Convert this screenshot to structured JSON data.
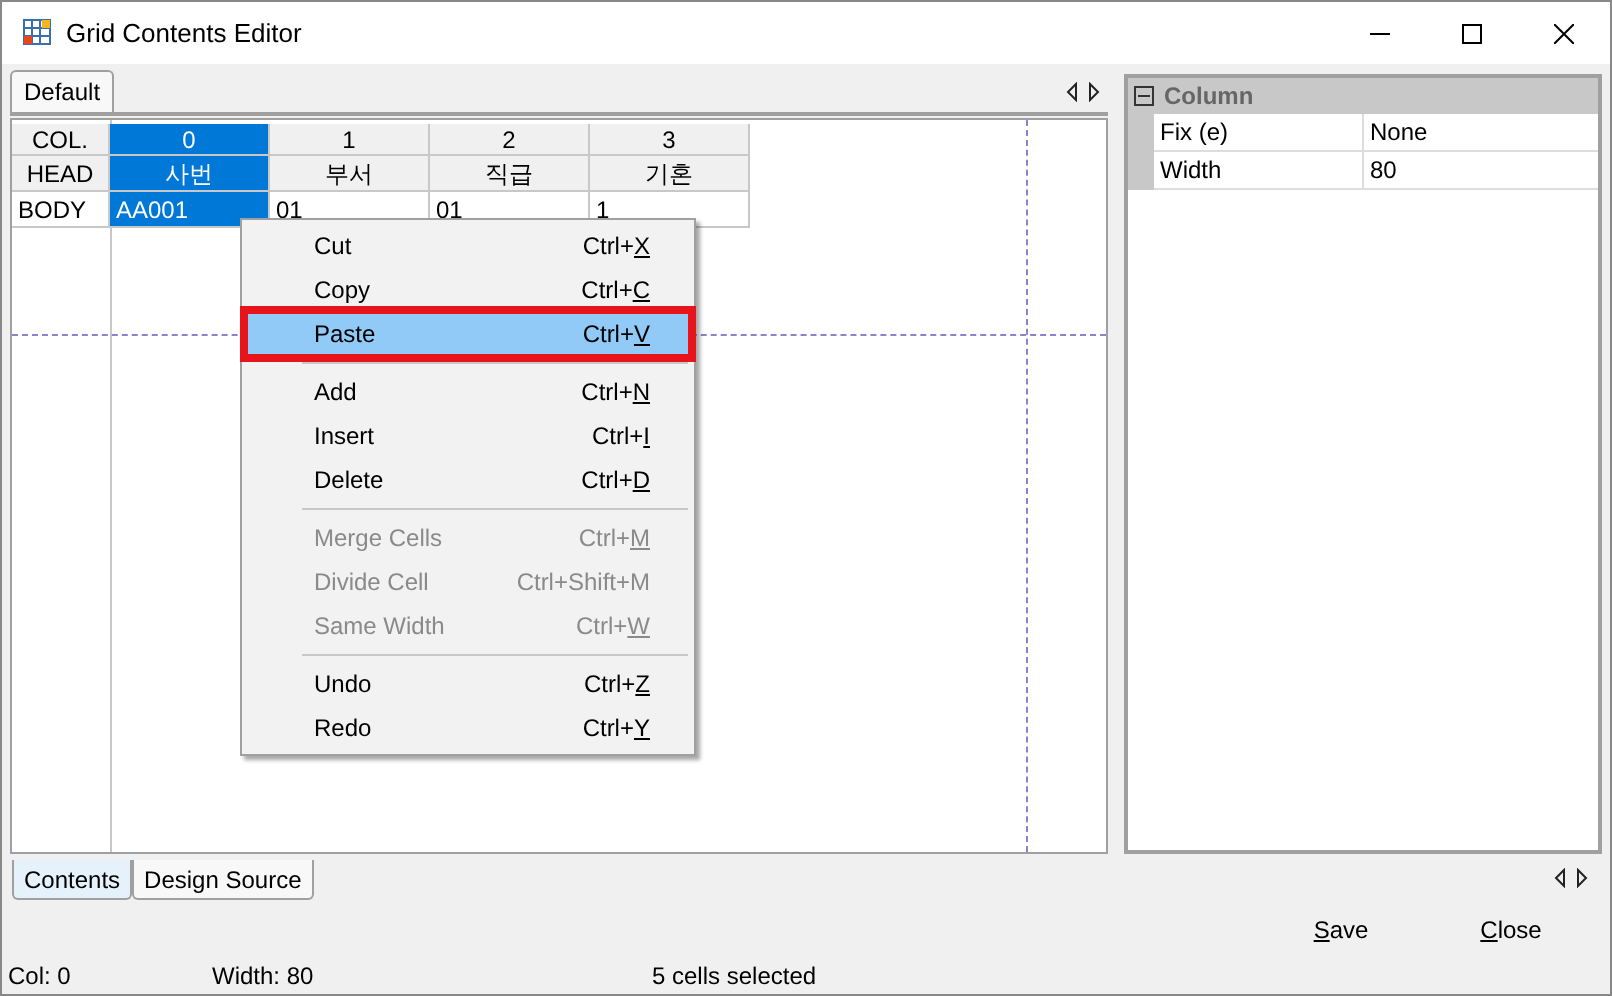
{
  "window": {
    "title": "Grid Contents Editor"
  },
  "top_tabs": [
    {
      "label": "Default",
      "selected": true
    }
  ],
  "grid": {
    "col_row": {
      "label": "COL.",
      "cells": [
        {
          "text": "0",
          "selected": true
        },
        {
          "text": "1",
          "selected": false
        },
        {
          "text": "2",
          "selected": false
        },
        {
          "text": "3",
          "selected": false
        }
      ]
    },
    "head_row": {
      "label": "HEAD",
      "cells": [
        {
          "text": "사번",
          "selected": true
        },
        {
          "text": "부서",
          "selected": false
        },
        {
          "text": "직급",
          "selected": false
        },
        {
          "text": "기혼",
          "selected": false
        }
      ]
    },
    "body_row": {
      "label": "BODY",
      "cells": [
        {
          "text": "AA001",
          "selected": true
        },
        {
          "text": "01",
          "selected": false
        },
        {
          "text": "01",
          "selected": false
        },
        {
          "text": "1",
          "selected": false
        }
      ]
    }
  },
  "context_menu": {
    "groups": [
      [
        {
          "label": "Cut",
          "shortcut": "Ctrl+X",
          "underlined": true,
          "disabled": false,
          "selected": false
        },
        {
          "label": "Copy",
          "shortcut": "Ctrl+C",
          "underlined": true,
          "disabled": false,
          "selected": false
        },
        {
          "label": "Paste",
          "shortcut": "Ctrl+V",
          "underlined": true,
          "disabled": false,
          "selected": true
        }
      ],
      [
        {
          "label": "Add",
          "shortcut": "Ctrl+N",
          "underlined": true,
          "disabled": false,
          "selected": false
        },
        {
          "label": "Insert",
          "shortcut": "Ctrl+I",
          "underlined": true,
          "disabled": false,
          "selected": false
        },
        {
          "label": "Delete",
          "shortcut": "Ctrl+D",
          "underlined": true,
          "disabled": false,
          "selected": false
        }
      ],
      [
        {
          "label": "Merge Cells",
          "shortcut": "Ctrl+M",
          "underlined": true,
          "disabled": true,
          "selected": false
        },
        {
          "label": "Divide Cell",
          "shortcut": "Ctrl+Shift+M",
          "underlined": false,
          "disabled": true,
          "selected": false
        },
        {
          "label": "Same Width",
          "shortcut": "Ctrl+W",
          "underlined": true,
          "disabled": true,
          "selected": false
        }
      ],
      [
        {
          "label": "Undo",
          "shortcut": "Ctrl+Z",
          "underlined": true,
          "disabled": false,
          "selected": false
        },
        {
          "label": "Redo",
          "shortcut": "Ctrl+Y",
          "underlined": true,
          "disabled": false,
          "selected": false
        }
      ]
    ]
  },
  "properties": {
    "category": "Column",
    "expanded": true,
    "rows": [
      {
        "name": "Fix (e)",
        "value": "None"
      },
      {
        "name": "Width",
        "value": "80"
      }
    ]
  },
  "bottom_tabs": [
    {
      "label": "Contents",
      "selected": true
    },
    {
      "label": "Design Source",
      "selected": false
    }
  ],
  "buttons": [
    "Save",
    "Close"
  ],
  "status_bar": [
    "Col: 0",
    "Width: 80",
    "5 cells selected"
  ]
}
